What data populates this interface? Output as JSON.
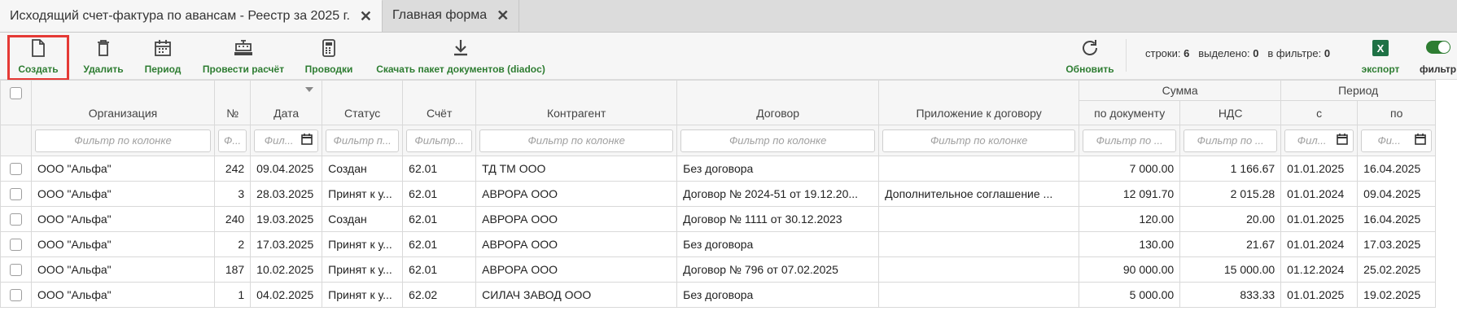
{
  "tabs": [
    {
      "label": "Исходящий счет-фактура по авансам - Реестр за 2025 г."
    },
    {
      "label": "Главная форма"
    }
  ],
  "toolbar": {
    "create": "Создать",
    "delete": "Удалить",
    "period": "Период",
    "calculate": "Провести расчёт",
    "postings": "Проводки",
    "download": "Скачать пакет документов (diadoc)",
    "refresh": "Обновить",
    "export": "экспорт",
    "filter": "фильтр",
    "stats": {
      "rows_label": "строки:",
      "rows": "6",
      "selected_label": "выделено:",
      "selected": "0",
      "in_filter_label": "в фильтре:",
      "in_filter": "0"
    }
  },
  "colors": {
    "accent": "#2e7d32",
    "highlight": "#e53935"
  },
  "grid": {
    "groups": {
      "sum": "Сумма",
      "period": "Период"
    },
    "columns": {
      "org": "Организация",
      "num": "№",
      "date": "Дата",
      "status": "Статус",
      "account": "Счёт",
      "contractor": "Контрагент",
      "contract": "Договор",
      "appendix": "Приложение к договору",
      "by_doc": "по документу",
      "vat": "НДС",
      "from": "с",
      "to": "по"
    },
    "filters": {
      "org": "Фильтр по колонке",
      "num": "Ф...",
      "date": "Фил...",
      "status": "Фильтр п...",
      "account": "Фильтр...",
      "contractor": "Фильтр по колонке",
      "contract": "Фильтр по колонке",
      "appendix": "Фильтр по колонке",
      "by_doc": "Фильтр по ...",
      "vat": "Фильтр по ...",
      "from": "Фил...",
      "to": "Фи..."
    },
    "rows": [
      {
        "org": "ООО \"Альфа\"",
        "num": "242",
        "date": "09.04.2025",
        "status": "Создан",
        "account": "62.01",
        "contractor": "ТД ТМ ООО",
        "contract": "Без договора",
        "appendix": "",
        "by_doc": "7 000.00",
        "vat": "1 166.67",
        "from": "01.01.2025",
        "to": "16.04.2025"
      },
      {
        "org": "ООО \"Альфа\"",
        "num": "3",
        "date": "28.03.2025",
        "status": "Принят к у...",
        "account": "62.01",
        "contractor": "АВРОРА ООО",
        "contract": "Договор № 2024-51 от 19.12.20...",
        "appendix": "Дополнительное соглашение ...",
        "by_doc": "12 091.70",
        "vat": "2 015.28",
        "from": "01.01.2024",
        "to": "09.04.2025"
      },
      {
        "org": "ООО \"Альфа\"",
        "num": "240",
        "date": "19.03.2025",
        "status": "Создан",
        "account": "62.01",
        "contractor": "АВРОРА ООО",
        "contract": "Договор № 1111 от 30.12.2023",
        "appendix": "",
        "by_doc": "120.00",
        "vat": "20.00",
        "from": "01.01.2025",
        "to": "16.04.2025"
      },
      {
        "org": "ООО \"Альфа\"",
        "num": "2",
        "date": "17.03.2025",
        "status": "Принят к у...",
        "account": "62.01",
        "contractor": "АВРОРА ООО",
        "contract": "Без договора",
        "appendix": "",
        "by_doc": "130.00",
        "vat": "21.67",
        "from": "01.01.2024",
        "to": "17.03.2025"
      },
      {
        "org": "ООО \"Альфа\"",
        "num": "187",
        "date": "10.02.2025",
        "status": "Принят к у...",
        "account": "62.01",
        "contractor": "АВРОРА ООО",
        "contract": "Договор № 796 от 07.02.2025",
        "appendix": "",
        "by_doc": "90 000.00",
        "vat": "15 000.00",
        "from": "01.12.2024",
        "to": "25.02.2025"
      },
      {
        "org": "ООО \"Альфа\"",
        "num": "1",
        "date": "04.02.2025",
        "status": "Принят к у...",
        "account": "62.02",
        "contractor": "СИЛАЧ ЗАВОД ООО",
        "contract": "Без договора",
        "appendix": "",
        "by_doc": "5 000.00",
        "vat": "833.33",
        "from": "01.01.2025",
        "to": "19.02.2025"
      }
    ]
  }
}
